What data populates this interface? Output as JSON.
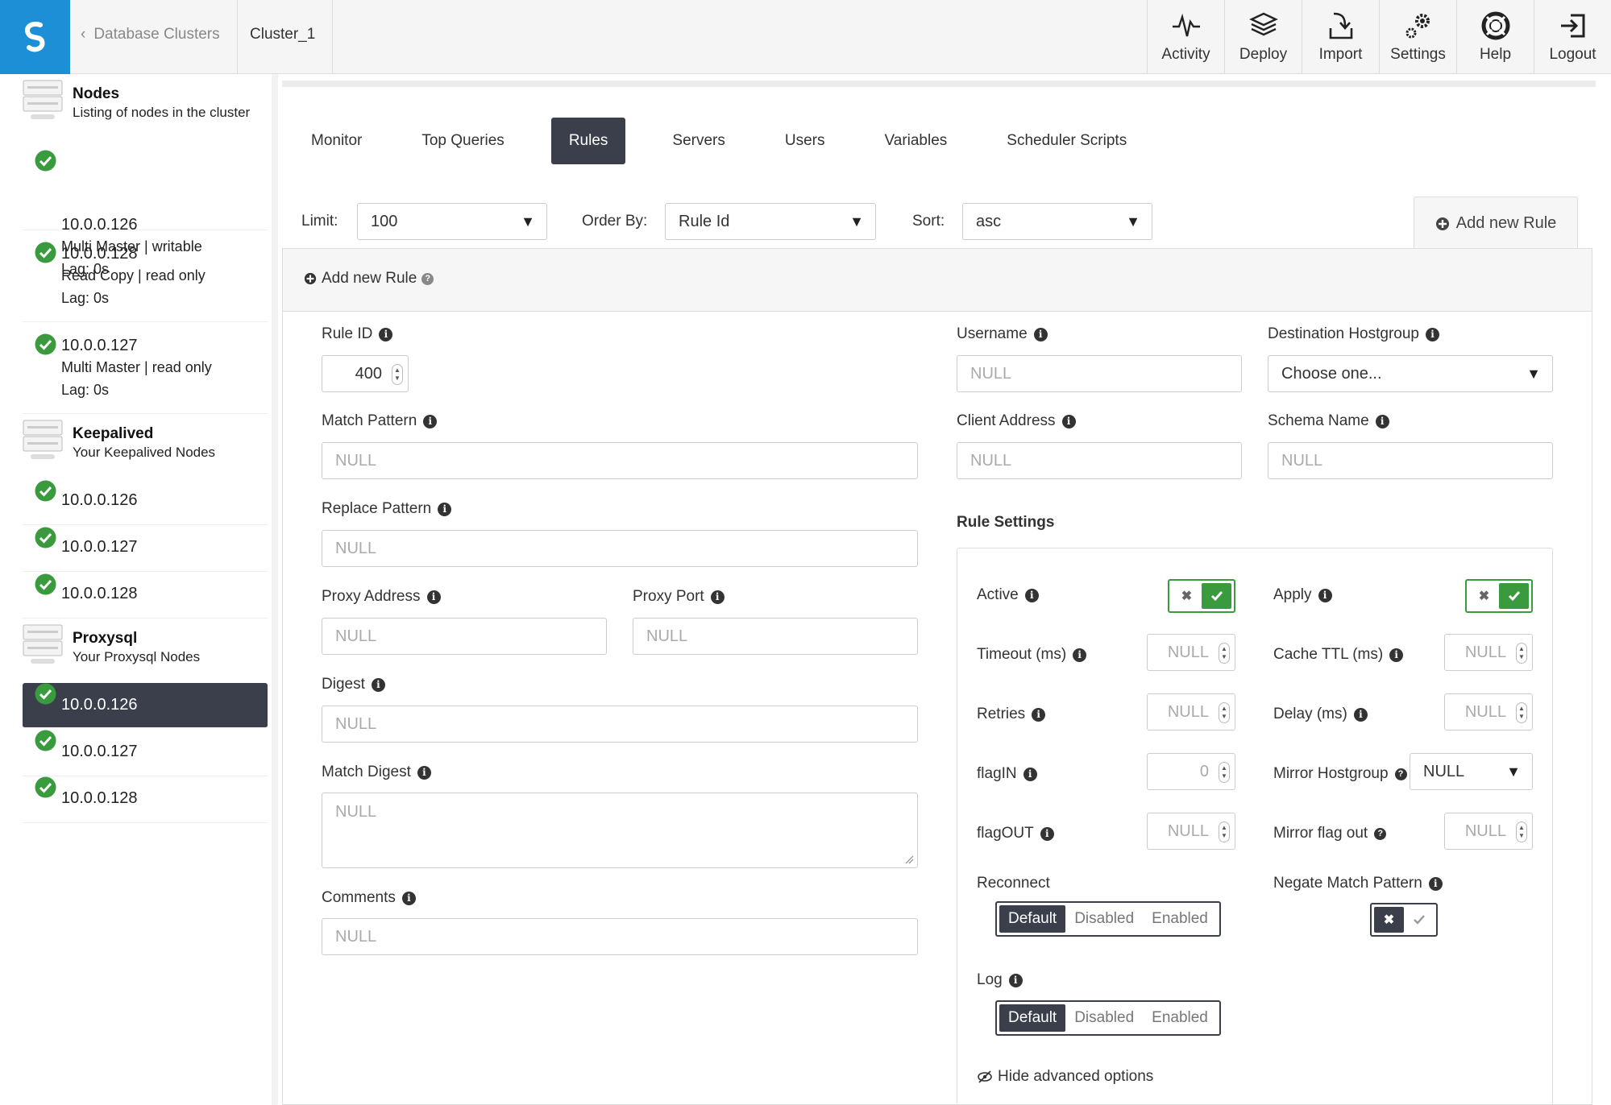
{
  "header": {
    "back_label": "Database Clusters",
    "current": "Cluster_1",
    "nav": [
      {
        "label": "Activity",
        "icon": "activity-icon"
      },
      {
        "label": "Deploy",
        "icon": "deploy-icon"
      },
      {
        "label": "Import",
        "icon": "import-icon"
      },
      {
        "label": "Settings",
        "icon": "settings-icon"
      },
      {
        "label": "Help",
        "icon": "help-icon"
      },
      {
        "label": "Logout",
        "icon": "logout-icon"
      }
    ]
  },
  "sidebar": {
    "nodes_section": {
      "title": "Nodes",
      "subtitle": "Listing of nodes in the cluster"
    },
    "nodes": [
      {
        "ip": "10.0.0.126",
        "role": "Multi Master | writable",
        "lag": "Lag: 0s"
      },
      {
        "ip": "10.0.0.128",
        "role": "Read Copy | read only",
        "lag": "Lag: 0s"
      },
      {
        "ip": "10.0.0.127",
        "role": "Multi Master | read only",
        "lag": "Lag: 0s"
      }
    ],
    "keepalived_section": {
      "title": "Keepalived",
      "subtitle": "Your Keepalived Nodes"
    },
    "keepalived": [
      "10.0.0.126",
      "10.0.0.127",
      "10.0.0.128"
    ],
    "proxysql_section": {
      "title": "Proxysql",
      "subtitle": "Your Proxysql Nodes"
    },
    "proxysql": [
      "10.0.0.126",
      "10.0.0.127",
      "10.0.0.128"
    ],
    "status_color": "#3a9b3e",
    "active_color": "#3b3f4c"
  },
  "tabs": [
    "Monitor",
    "Top Queries",
    "Rules",
    "Servers",
    "Users",
    "Variables",
    "Scheduler Scripts"
  ],
  "active_tab": "Rules",
  "filters": {
    "limit_label": "Limit:",
    "limit_value": "100",
    "order_label": "Order By:",
    "order_value": "Rule Id",
    "sort_label": "Sort:",
    "sort_value": "asc"
  },
  "add_rule_tab": "Add new Rule",
  "form": {
    "title": "Add new Rule",
    "rule_id_label": "Rule ID",
    "rule_id_value": "400",
    "match_pattern_label": "Match Pattern",
    "match_pattern_placeholder": "NULL",
    "replace_pattern_label": "Replace Pattern",
    "replace_pattern_placeholder": "NULL",
    "proxy_address_label": "Proxy Address",
    "proxy_address_placeholder": "NULL",
    "proxy_port_label": "Proxy Port",
    "proxy_port_placeholder": "NULL",
    "digest_label": "Digest",
    "digest_placeholder": "NULL",
    "match_digest_label": "Match Digest",
    "match_digest_placeholder": "NULL",
    "comments_label": "Comments",
    "comments_placeholder": "NULL",
    "username_label": "Username",
    "username_placeholder": "NULL",
    "dest_hostgroup_label": "Destination Hostgroup",
    "dest_hostgroup_value": "Choose one...",
    "client_address_label": "Client Address",
    "client_address_placeholder": "NULL",
    "schema_name_label": "Schema Name",
    "schema_name_placeholder": "NULL"
  },
  "rule_settings": {
    "title": "Rule Settings",
    "active_label": "Active",
    "apply_label": "Apply",
    "timeout_label": "Timeout (ms)",
    "timeout_value": "NULL",
    "cache_ttl_label": "Cache TTL (ms)",
    "cache_ttl_value": "NULL",
    "retries_label": "Retries",
    "retries_value": "NULL",
    "delay_label": "Delay (ms)",
    "delay_value": "NULL",
    "flagin_label": "flagIN",
    "flagin_value": "0",
    "mirror_hostgroup_label": "Mirror Hostgroup",
    "mirror_hostgroup_value": "NULL",
    "flagout_label": "flagOUT",
    "flagout_value": "NULL",
    "mirror_flag_out_label": "Mirror flag out",
    "mirror_flag_out_value": "NULL",
    "reconnect_label": "Reconnect",
    "negate_label": "Negate Match Pattern",
    "log_label": "Log",
    "segment_options": [
      "Default",
      "Disabled",
      "Enabled"
    ],
    "hide_advanced": "Hide advanced options"
  }
}
